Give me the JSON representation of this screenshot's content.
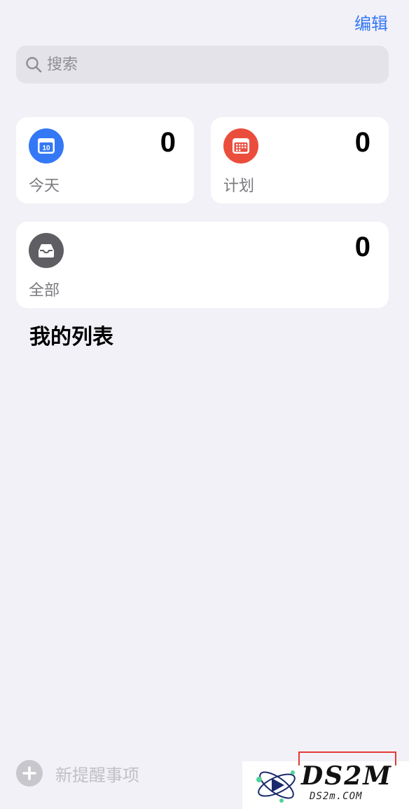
{
  "header": {
    "edit_label": "编辑"
  },
  "search": {
    "placeholder": "搜索"
  },
  "cards": {
    "today": {
      "label": "今天",
      "count": "0",
      "icon": "calendar-today-icon",
      "icon_number": "10",
      "color": "#3478f6"
    },
    "scheduled": {
      "label": "计划",
      "count": "0",
      "icon": "calendar-grid-icon",
      "color": "#eb4d3d"
    },
    "all": {
      "label": "全部",
      "count": "0",
      "icon": "inbox-tray-icon",
      "color": "#5e5e63"
    }
  },
  "section": {
    "title": "我的列表"
  },
  "footer": {
    "new_reminder_label": "新提醒事项",
    "icon": "plus-circle-icon"
  },
  "watermark": {
    "brand": "DS2M",
    "url": "DS2m.COM"
  },
  "colors": {
    "accent": "#3478f6",
    "background": "#f2f1f7",
    "card": "#ffffff"
  }
}
